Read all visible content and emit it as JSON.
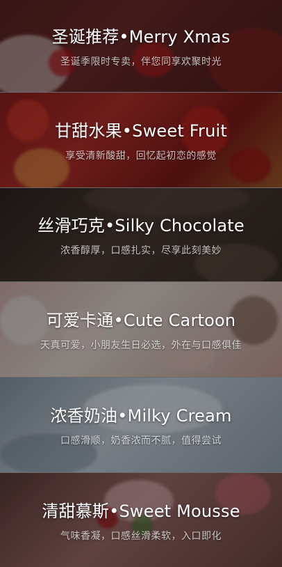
{
  "cards": [
    {
      "title": "圣诞推荐•Merry Xmas",
      "subtitle": "圣诞季限时专卖，伴您同享欢聚时光"
    },
    {
      "title": "甘甜水果•Sweet Fruit",
      "subtitle": "享受清新酸甜，回忆起初恋的感觉"
    },
    {
      "title": "丝滑巧克•Silky Chocolate",
      "subtitle": "浓香醇厚，口感扎实，尽享此刻美妙"
    },
    {
      "title": "可爱卡通•Cute Cartoon",
      "subtitle": "天真可爱，小朋友生日必选，外在与口感俱佳"
    },
    {
      "title": "浓香奶油•Milky Cream",
      "subtitle": "口感滑顺，奶香浓而不腻，值得尝试"
    },
    {
      "title": "清甜慕斯•Sweet Mousse",
      "subtitle": "气味香凝，口感丝滑柔软，入口即化"
    }
  ]
}
